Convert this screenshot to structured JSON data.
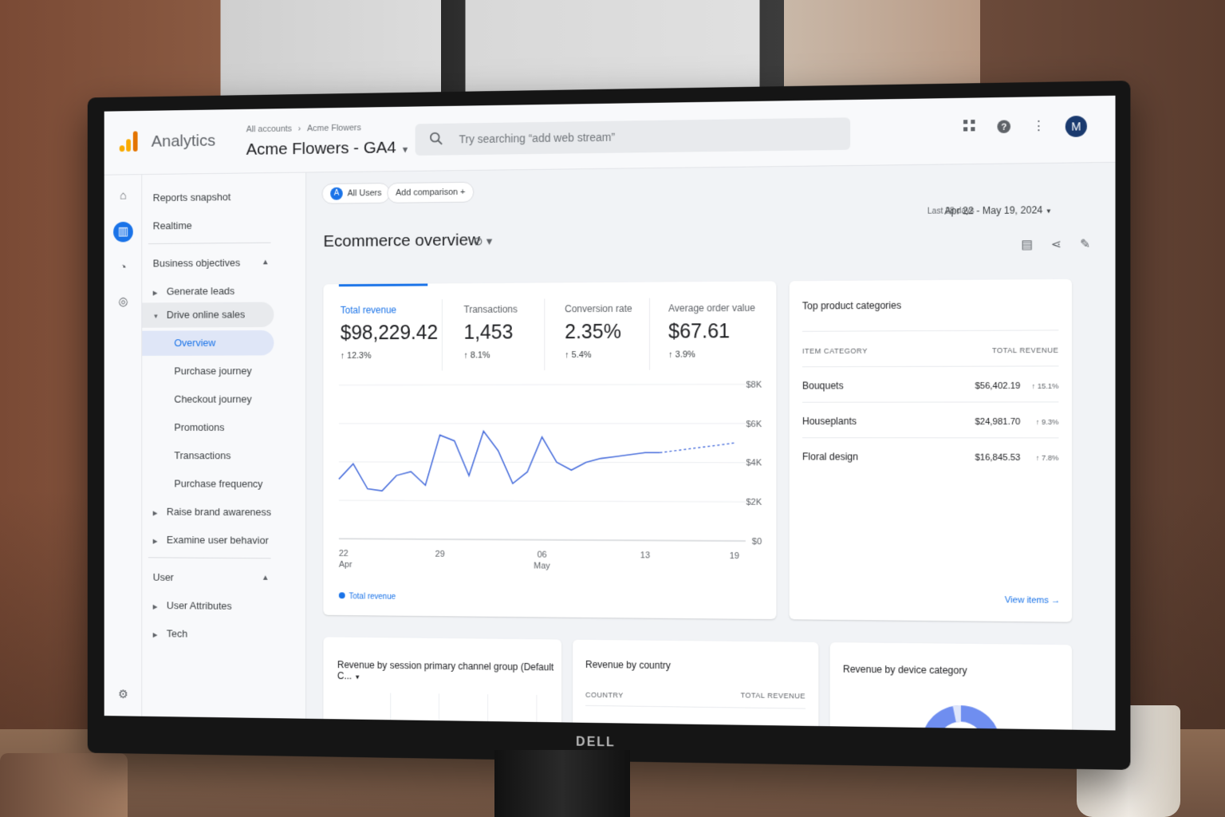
{
  "header": {
    "app_name": "Analytics",
    "breadcrumb": [
      "All accounts",
      "Acme Flowers"
    ],
    "property": "Acme Flowers - GA4",
    "search_placeholder": "Try searching “add web stream”",
    "avatar_letter": "M",
    "icons": [
      "apps-grid-icon",
      "help-icon",
      "more-vert-icon"
    ]
  },
  "rail": {
    "icons": [
      "home-icon",
      "reports-icon",
      "explore-icon",
      "advertising-icon",
      "settings-icon"
    ]
  },
  "nav": {
    "top": [
      "Reports snapshot",
      "Realtime"
    ],
    "section1": "Business objectives",
    "groups": [
      {
        "label": "Generate leads",
        "expanded": false
      },
      {
        "label": "Drive online sales",
        "expanded": true,
        "children": [
          "Overview",
          "Purchase journey",
          "Checkout journey",
          "Promotions",
          "Transactions",
          "Purchase frequency"
        ]
      },
      {
        "label": "Raise brand awareness",
        "expanded": false
      },
      {
        "label": "Examine user behavior",
        "expanded": false
      }
    ],
    "section2": "User",
    "user_groups": [
      "User Attributes",
      "Tech"
    ],
    "selected": "Overview"
  },
  "toolbar": {
    "segment_chip": "All Users",
    "segment_letter": "A",
    "add_comparison": "Add comparison",
    "date_label": "Last 28 days",
    "date_range": "Apr 22 - May 19, 2024"
  },
  "page": {
    "title": "Ecommerce overview"
  },
  "kpis": [
    {
      "label": "Total revenue",
      "value": "$98,229.42",
      "delta": "12.3%"
    },
    {
      "label": "Transactions",
      "value": "1,453",
      "delta": "8.1%"
    },
    {
      "label": "Conversion rate",
      "value": "2.35%",
      "delta": "5.4%"
    },
    {
      "label": "Average order value",
      "value": "$67.61",
      "delta": "3.9%"
    }
  ],
  "chart_data": {
    "type": "line",
    "title": "",
    "x_ticks": [
      {
        "label": "22",
        "sub": "Apr",
        "day": 0
      },
      {
        "label": "29",
        "sub": "",
        "day": 7
      },
      {
        "label": "06",
        "sub": "May",
        "day": 14
      },
      {
        "label": "13",
        "sub": "",
        "day": 21
      },
      {
        "label": "19",
        "sub": "",
        "day": 27
      }
    ],
    "y_ticks": [
      "$8K",
      "$6K",
      "$4K",
      "$2K",
      "$0"
    ],
    "ylim": [
      0,
      8000
    ],
    "series": [
      {
        "name": "Total revenue",
        "x": [
          "Apr 22",
          "Apr 23",
          "Apr 24",
          "Apr 25",
          "Apr 26",
          "Apr 27",
          "Apr 28",
          "Apr 29",
          "Apr 30",
          "May 1",
          "May 2",
          "May 3",
          "May 4",
          "May 5",
          "May 6",
          "May 7",
          "May 8",
          "May 9",
          "May 10",
          "May 11",
          "May 12",
          "May 13",
          "May 14",
          "May 15",
          "May 16",
          "May 17",
          "May 18",
          "May 19"
        ],
        "values": [
          3100,
          3900,
          2600,
          2500,
          3300,
          3500,
          2800,
          5400,
          5100,
          3300,
          5600,
          4600,
          2900,
          3500,
          5300,
          4000,
          3600,
          4000,
          4200,
          4300,
          4400,
          4500,
          4500,
          4600,
          4700,
          4800,
          4900,
          5000
        ],
        "dashed_from": 22
      }
    ],
    "legend": [
      "Total revenue"
    ]
  },
  "top_categories": {
    "title": "Top product categories",
    "col_category": "ITEM CATEGORY",
    "col_revenue": "TOTAL REVENUE",
    "rows": [
      {
        "category": "Bouquets",
        "revenue": "$56,402.19",
        "change": "15.1%"
      },
      {
        "category": "Houseplants",
        "revenue": "$24,981.70",
        "change": "9.3%"
      },
      {
        "category": "Floral design",
        "revenue": "$16,845.53",
        "change": "7.8%"
      }
    ],
    "view_items": "View items"
  },
  "bottom_cards": {
    "channel_title": "Revenue by session primary channel group (Default C...",
    "country_title": "Revenue by country",
    "country_col": "COUNTRY",
    "country_rev_col": "TOTAL REVENUE",
    "device_title": "Revenue by device category"
  },
  "colors": {
    "accent": "#1a73e8",
    "logo_light": "#f9ab00",
    "logo_dark": "#e37400"
  }
}
